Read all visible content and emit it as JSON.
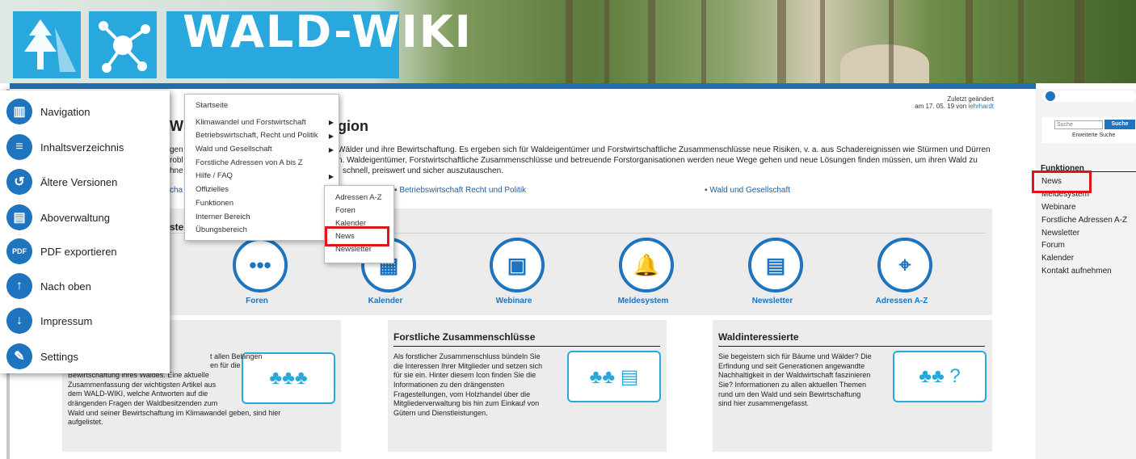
{
  "header": {
    "logo_text": "WALD-WIKI"
  },
  "side_menu": [
    {
      "label": "Navigation",
      "icon": "books-icon"
    },
    {
      "label": "Inhaltsverzeichnis",
      "icon": "list-icon"
    },
    {
      "label": "Ältere Versionen",
      "icon": "history-icon"
    },
    {
      "label": "Aboverwaltung",
      "icon": "subscription-icon"
    },
    {
      "label": "PDF exportieren",
      "icon": "pdf-icon"
    },
    {
      "label": "Nach oben",
      "icon": "arrow-up-icon"
    },
    {
      "label": "Impressum",
      "icon": "arrow-down-icon"
    },
    {
      "label": "Settings",
      "icon": "wrench-icon"
    }
  ],
  "dropdown": {
    "items": [
      "Startseite",
      "Klimawandel und Forstwirtschaft",
      "Betriebswirtschaft, Recht und Politik",
      "Wald und Gesellschaft",
      "Forstliche Adressen von A bis Z",
      "Hilfe / FAQ",
      "Offizielles",
      "Funktionen",
      "Interner Bereich",
      "Übungsbereich"
    ],
    "submenu": [
      "Adressen A-Z",
      "Foren",
      "Kalender",
      "News",
      "Newsletter"
    ]
  },
  "page": {
    "title_left": "Wi",
    "title_right": "gion",
    "updated_line1": "Zuletzt geändert",
    "updated_line2_prefix": "am 17. 05. 19 von",
    "updated_user": "lehrhardt",
    "intro": [
      "gen",
      "Wälder und ihre Bewirtschaftung. Es ergeben sich für Waldeigentümer und Forstwirtschaftliche Zusammenschlüsse neue Risiken, v. a. aus Schadereignissen wie Stürmen und Dürren",
      "robl",
      "n. Waldeigentümer, Forstwirtschaftliche Zusammenschlüsse und betreuende Forstorganisationen werden neue Wege gehen und neue Lösungen finden müssen, um ihren Wald zu",
      "hne",
      "schnell, preiswert und sicher auszutauschen."
    ],
    "topic_links": [
      "cha",
      "Betriebswirtschaft Recht und Politik",
      "Wald und Gesellschaft"
    ],
    "section_fragment": "ste"
  },
  "functions": [
    {
      "label": "Foren",
      "icon": "chat-bubble-icon",
      "glyph": "•••"
    },
    {
      "label": "Kalender",
      "icon": "calendar-icon",
      "glyph": "▦"
    },
    {
      "label": "Webinare",
      "icon": "webinar-icon",
      "glyph": "▣"
    },
    {
      "label": "Meldesystem",
      "icon": "bell-icon",
      "glyph": "🔔"
    },
    {
      "label": "Newsletter",
      "icon": "newspaper-icon",
      "glyph": "▤"
    },
    {
      "label": "Adressen A-Z",
      "icon": "map-pin-icon",
      "glyph": "⌖"
    }
  ],
  "cards": [
    {
      "title": "",
      "lines": [
        "t allen Belangen",
        "en für die",
        "Bewirtschaftung ihres Waldes. Eine aktuelle",
        "Zusammenfassung der wichtigsten Artikel aus",
        "dem WALD-WIKI, welche Antworten auf die",
        "drängenden Fragen der Waldbesitzenden zum",
        "Wald und seiner Bewirtschaftung im Klimawandel geben, sind hier",
        "aufgelistet."
      ]
    },
    {
      "title": "Forstliche Zusammenschlüsse",
      "lines": [
        "Als forstlicher Zusammenschluss bündeln Sie",
        "die Interessen Ihrer Mitglieder und setzen sich",
        "für sie ein. Hinter diesem Icon finden Sie die",
        "Informationen zu den drängensten",
        "Fragestellungen, vom Holzhandel über die",
        "Mitgliederverwaltung bis hin zum Einkauf von",
        "Gütern und Dienstleistungen."
      ]
    },
    {
      "title": "Waldinteressierte",
      "lines": [
        "Sie begeistern sich für Bäume und Wälder? Die",
        "Erfindung und seit Generationen angewandte",
        "Nachhaltigkeit in der Waldwirtschaft faszinieren",
        "Sie? Informationen zu allen aktuellen Themen",
        "rund um den Wald und sein Bewirtschaftung",
        "sind hier zusammengefasst."
      ]
    }
  ],
  "right_sidebar": {
    "search_placeholder": "Suche",
    "search_button": "Suche",
    "advanced_search": "Erweiterte Suche",
    "heading": "Funktionen",
    "items": [
      "News",
      "Meldesystem",
      "Webinare",
      "Forstliche Adressen A-Z",
      "Newsletter",
      "Forum",
      "Kalender",
      "Kontakt aufnehmen"
    ]
  },
  "colors": {
    "brand_blue": "#1e74be",
    "logo_cyan": "#29a8de",
    "highlight_red": "#e0141b"
  }
}
